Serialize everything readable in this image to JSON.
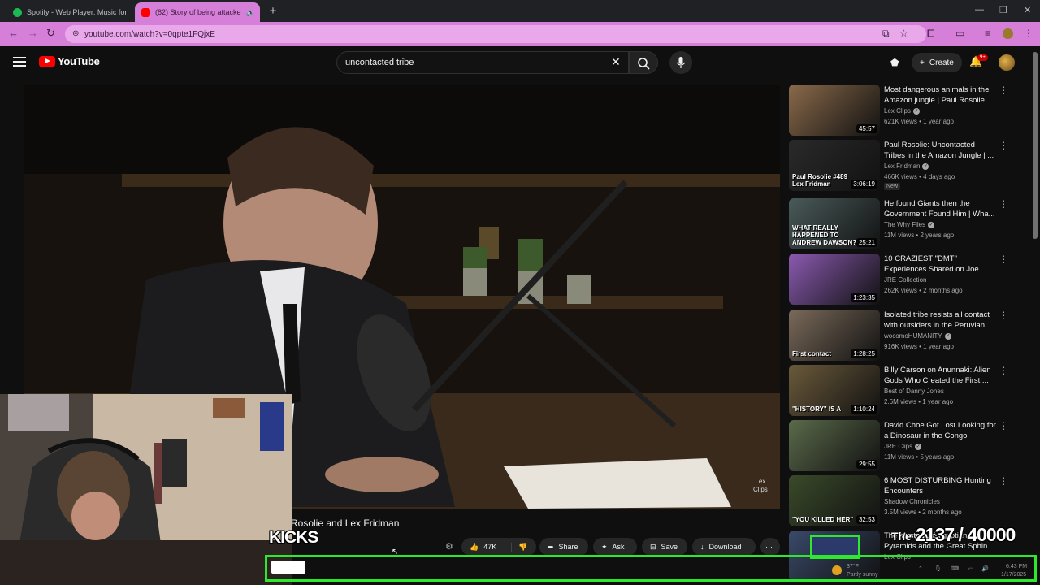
{
  "browser": {
    "tabs": [
      {
        "label": "Spotify - Web Player: Music for",
        "favicon_color": "#1db954",
        "active": false
      },
      {
        "label": "(82) Story of being attacke",
        "favicon_color": "#ff0000",
        "active": true
      }
    ],
    "url": "youtube.com/watch?v=0qpte1FQjxE",
    "accent": "#d67fd8"
  },
  "youtube": {
    "logo_text": "YouTube",
    "search_query": "uncontacted tribe",
    "create_label": "Create",
    "notification_count": "9+"
  },
  "video": {
    "title": "Rosolie and Lex Fridman",
    "watermark_line1": "Lex",
    "watermark_line2": "Clips",
    "actions": {
      "like_count": "47K",
      "share": "Share",
      "ask": "Ask",
      "save": "Save",
      "download": "Download"
    }
  },
  "overlays": {
    "kicks_label": "KICKS",
    "counter": "2137 / 40000",
    "counter_prefix": "The myst",
    "green": "#2ee82e"
  },
  "recommendations": [
    {
      "title": "Most dangerous animals in the Amazon jungle | Paul Rosolie ...",
      "channel": "Lex Clips",
      "verified": true,
      "meta": "621K views • 1 year ago",
      "duration": "45:57",
      "new": "",
      "thumb": "#8a6a4a"
    },
    {
      "title": "Paul Rosolie: Uncontacted Tribes in the Amazon Jungle | ...",
      "channel": "Lex Fridman",
      "verified": true,
      "meta": "466K views • 4 days ago",
      "duration": "3:06:19",
      "new": "New",
      "thumb": "#2a2a2a",
      "thumb_text": "Paul Rosolie #489 Lex Fridman"
    },
    {
      "title": "He found Giants then the Government Found Him | Wha...",
      "channel": "The Why Files",
      "verified": true,
      "meta": "11M views • 2 years ago",
      "duration": "25:21",
      "new": "",
      "thumb": "#4a5a5a",
      "thumb_text": "WHAT REALLY HAPPENED TO ANDREW DAWSON?"
    },
    {
      "title": "10 CRAZIEST \"DMT\" Experiences Shared on Joe ...",
      "channel": "JRE Collection",
      "verified": false,
      "meta": "262K views • 2 months ago",
      "duration": "1:23:35",
      "new": "",
      "thumb": "#8a5ab0"
    },
    {
      "title": "Isolated tribe resists all contact with outsiders in the Peruvian ...",
      "channel": "wocomoHUMANITY",
      "verified": true,
      "meta": "916K views • 1 year ago",
      "duration": "1:28:25",
      "new": "",
      "thumb": "#7a6a5a",
      "thumb_text": "First contact"
    },
    {
      "title": "Billy Carson on Anunnaki: Alien Gods Who Created the First ...",
      "channel": "Best of Danny Jones",
      "verified": false,
      "meta": "2.6M views • 1 year ago",
      "duration": "1:10:24",
      "new": "",
      "thumb": "#6a5a3a",
      "thumb_text": "\"HISTORY\" IS A"
    },
    {
      "title": "David Choe Got Lost Looking for a Dinosaur in the Congo",
      "channel": "JRE Clips",
      "verified": true,
      "meta": "11M views • 5 years ago",
      "duration": "29:55",
      "new": "",
      "thumb": "#5a6a4a"
    },
    {
      "title": "6 MOST DISTURBING Hunting Encounters",
      "channel": "Shadow Chronicles",
      "verified": false,
      "meta": "3.5M views • 2 months ago",
      "duration": "32:53",
      "new": "",
      "thumb": "#3a4a2a",
      "thumb_text": "\"YOU KILLED HER\""
    },
    {
      "title": "The Mystery of Egyptian Pyramids and the Great Sphin...",
      "channel": "Lex Clips",
      "verified": false,
      "meta": "",
      "duration": "",
      "new": "",
      "thumb": "#3a4a6a"
    }
  ],
  "taskbar": {
    "weather_temp": "37°F",
    "weather_desc": "Partly sunny",
    "time": "6:43 PM",
    "date": "1/17/2025"
  }
}
